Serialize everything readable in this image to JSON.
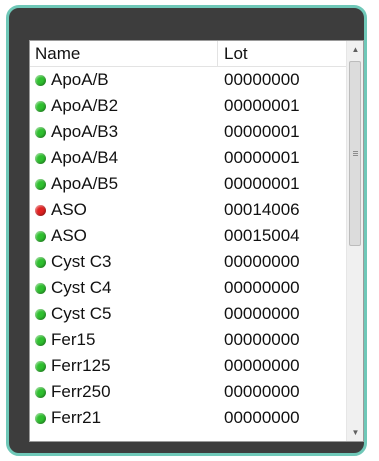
{
  "columns": {
    "name": "Name",
    "lot": "Lot"
  },
  "status_colors": {
    "ok": "#2fbf2f",
    "error": "#e02020"
  },
  "rows": [
    {
      "name": "ApoA/B",
      "lot": "00000000",
      "status": "ok"
    },
    {
      "name": "ApoA/B2",
      "lot": "00000001",
      "status": "ok"
    },
    {
      "name": "ApoA/B3",
      "lot": "00000001",
      "status": "ok"
    },
    {
      "name": "ApoA/B4",
      "lot": "00000001",
      "status": "ok"
    },
    {
      "name": "ApoA/B5",
      "lot": "00000001",
      "status": "ok"
    },
    {
      "name": "ASO",
      "lot": "00014006",
      "status": "error"
    },
    {
      "name": "ASO",
      "lot": "00015004",
      "status": "ok"
    },
    {
      "name": "Cyst C3",
      "lot": "00000000",
      "status": "ok"
    },
    {
      "name": "Cyst C4",
      "lot": "00000000",
      "status": "ok"
    },
    {
      "name": "Cyst C5",
      "lot": "00000000",
      "status": "ok"
    },
    {
      "name": "Fer15",
      "lot": "00000000",
      "status": "ok"
    },
    {
      "name": "Ferr125",
      "lot": "00000000",
      "status": "ok"
    },
    {
      "name": "Ferr250",
      "lot": "00000000",
      "status": "ok"
    },
    {
      "name": "Ferr21",
      "lot": "00000000",
      "status": "ok"
    }
  ],
  "scrollbar": {
    "up_icon": "arrow-up-icon",
    "down_icon": "arrow-down-icon",
    "position": 0
  }
}
